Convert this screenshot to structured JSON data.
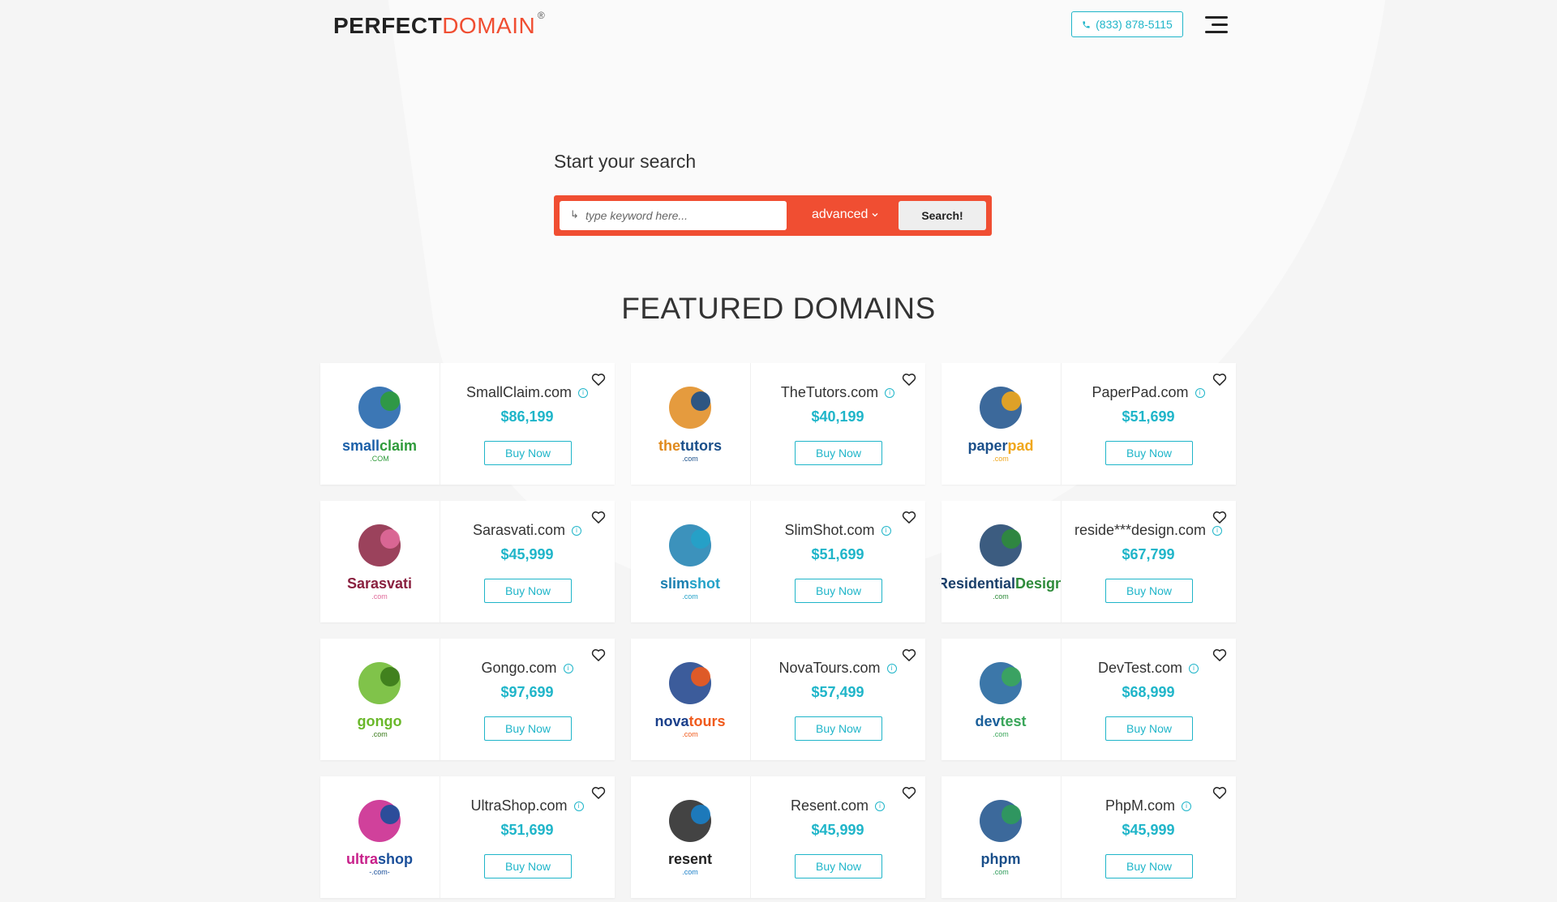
{
  "header": {
    "logo_bold": "PERFECT",
    "logo_light": "DOMAIN",
    "logo_mark": "®",
    "phone_icon": "phone-icon",
    "phone": "(833) 878-5115",
    "menu_icon": "hamburger-menu-icon"
  },
  "search": {
    "title": "Start your search",
    "placeholder": "type keyword here...",
    "input_icon": "↳",
    "advanced_label": "advanced",
    "button_label": "Search!"
  },
  "featured": {
    "title": "FEATURED DOMAINS",
    "buy_label": "Buy Now",
    "domains": [
      {
        "name": "SmallClaim.com",
        "price": "$86,199",
        "logo": [
          "small",
          "claim",
          ".COM"
        ],
        "colors": [
          "#1a5fa8",
          "#2e9b3a"
        ]
      },
      {
        "name": "TheTutors.com",
        "price": "$40,199",
        "logo": [
          "the",
          "tutors",
          ".com"
        ],
        "colors": [
          "#e08a1c",
          "#1a4f8a"
        ]
      },
      {
        "name": "PaperPad.com",
        "price": "$51,699",
        "logo": [
          "paper",
          "pad",
          ".com"
        ],
        "colors": [
          "#1a4f8a",
          "#f0a71c"
        ]
      },
      {
        "name": "Sarasvati.com",
        "price": "$45,999",
        "logo": [
          "Sarasvati",
          "",
          ".com"
        ],
        "colors": [
          "#8a2140",
          "#e06a9a"
        ]
      },
      {
        "name": "SlimShot.com",
        "price": "$51,699",
        "logo": [
          "slim",
          "shot",
          ".com"
        ],
        "colors": [
          "#1a7fb0",
          "#24a2c8"
        ]
      },
      {
        "name": "reside***design.com",
        "price": "$67,799",
        "logo": [
          "Residential",
          "Design",
          ".com"
        ],
        "colors": [
          "#1a3f6a",
          "#2e8b3a"
        ]
      },
      {
        "name": "Gongo.com",
        "price": "$97,699",
        "logo": [
          "gongo",
          "",
          ".com"
        ],
        "colors": [
          "#6ab82a",
          "#3a7a1a"
        ]
      },
      {
        "name": "NovaTours.com",
        "price": "$57,499",
        "logo": [
          "nova",
          "tours",
          ".com"
        ],
        "colors": [
          "#1a3f8a",
          "#f05a1c"
        ]
      },
      {
        "name": "DevTest.com",
        "price": "$68,999",
        "logo": [
          "dev",
          "test",
          ".com"
        ],
        "colors": [
          "#1a5f9a",
          "#3aa65a"
        ]
      },
      {
        "name": "UltraShop.com",
        "price": "$51,699",
        "logo": [
          "ultra",
          "shop",
          "-.com-"
        ],
        "colors": [
          "#c8208a",
          "#1a4f9a"
        ]
      },
      {
        "name": "Resent.com",
        "price": "$45,999",
        "logo": [
          "resent",
          "",
          ".com"
        ],
        "colors": [
          "#222222",
          "#1a7fc8"
        ]
      },
      {
        "name": "PhpM.com",
        "price": "$45,999",
        "logo": [
          "phpm",
          "",
          ".com"
        ],
        "colors": [
          "#1a4f8a",
          "#2e9b5a"
        ]
      }
    ]
  },
  "colors": {
    "accent": "#1fb5c9",
    "brand": "#f04e32",
    "background": "#f5f5f5"
  }
}
